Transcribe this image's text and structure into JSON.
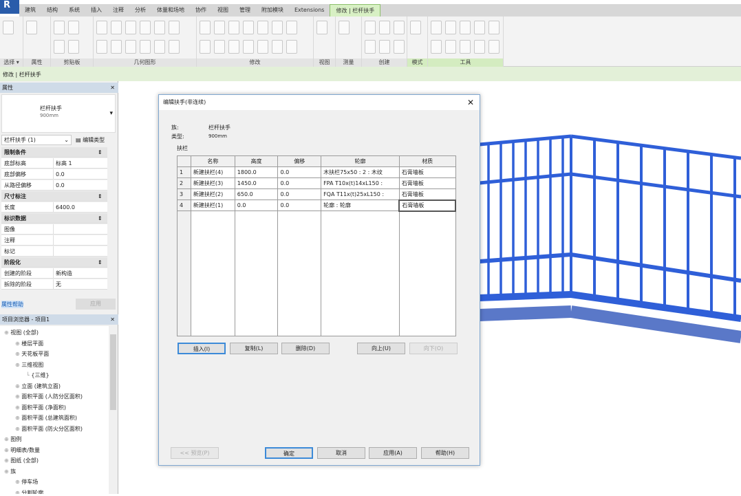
{
  "app": {
    "logo": "R"
  },
  "ribbon": {
    "tabs": [
      "建筑",
      "结构",
      "系统",
      "插入",
      "注释",
      "分析",
      "体量和场地",
      "协作",
      "视图",
      "管理",
      "附加模块",
      "Extensions",
      "修改 | 栏杆扶手"
    ],
    "active_tab": "修改 | 栏杆扶手",
    "panels": [
      "选择 ▾",
      "属性",
      "剪贴板",
      "几何图形",
      "修改",
      "视图",
      "测量",
      "创建",
      "模式",
      "工具"
    ],
    "accent": "#8cc06a"
  },
  "optbar": {
    "context": "修改 | 栏杆扶手"
  },
  "properties": {
    "title": "属性",
    "type_name": "栏杆扶手",
    "type_sub": "900mm",
    "selector": "栏杆扶手 (1)",
    "edit_type": "编辑类型",
    "groups": [
      {
        "name": "限制条件",
        "rows": [
          [
            "底部标高",
            "标高 1"
          ],
          [
            "底部偏移",
            "0.0"
          ],
          [
            "从路径偏移",
            "0.0"
          ]
        ]
      },
      {
        "name": "尺寸标注",
        "rows": [
          [
            "长度",
            "6400.0"
          ]
        ]
      },
      {
        "name": "标识数据",
        "rows": [
          [
            "图像",
            ""
          ],
          [
            "注释",
            ""
          ],
          [
            "标记",
            ""
          ]
        ]
      },
      {
        "name": "阶段化",
        "rows": [
          [
            "创建的阶段",
            "新构造"
          ],
          [
            "拆除的阶段",
            "无"
          ]
        ]
      }
    ],
    "help": "属性帮助",
    "apply": "应用"
  },
  "browser": {
    "title": "项目浏览器 - 项目1",
    "items": [
      {
        "label": "视图 (全部)",
        "level": 0
      },
      {
        "label": "楼层平面",
        "level": 1
      },
      {
        "label": "天花板平面",
        "level": 1
      },
      {
        "label": "三维视图",
        "level": 1
      },
      {
        "label": "{三维}",
        "level": 2
      },
      {
        "label": "立面 (建筑立面)",
        "level": 1
      },
      {
        "label": "面积平面 (人防分区面积)",
        "level": 1
      },
      {
        "label": "面积平面 (净面积)",
        "level": 1
      },
      {
        "label": "面积平面 (总建筑面积)",
        "level": 1
      },
      {
        "label": "面积平面 (防火分区面积)",
        "level": 1
      },
      {
        "label": "图例",
        "level": 0
      },
      {
        "label": "明细表/数量",
        "level": 0
      },
      {
        "label": "图纸 (全部)",
        "level": 0
      },
      {
        "label": "族",
        "level": 0
      },
      {
        "label": "停车场",
        "level": 1
      },
      {
        "label": "分割轮廓",
        "level": 1
      }
    ]
  },
  "dialog": {
    "title": "编辑扶手(非连续)",
    "family_label": "族:",
    "family": "栏杆扶手",
    "type_label": "类型:",
    "type": "900mm",
    "section": "扶栏",
    "columns": [
      "名称",
      "高度",
      "偏移",
      "轮廓",
      "材质"
    ],
    "rows": [
      [
        "1",
        "新建扶栏(4)",
        "1800.0",
        "0.0",
        "木扶栏75x50 : 2 : 木纹",
        "石膏墙板"
      ],
      [
        "2",
        "新建扶栏(3)",
        "1450.0",
        "0.0",
        "FPA T10x(t)14xL150 :",
        "石膏墙板"
      ],
      [
        "3",
        "新建扶栏(2)",
        "650.0",
        "0.0",
        "FQA T11x(t)25xL150 :",
        "石膏墙板"
      ],
      [
        "4",
        "新建扶栏(1)",
        "0.0",
        "0.0",
        "轮廓 : 轮廓",
        "石膏墙板"
      ]
    ],
    "buttons": {
      "insert": "插入(I)",
      "copy": "复制(L)",
      "delete": "删除(D)",
      "up": "向上(U)",
      "down": "向下(O)",
      "preview": "<< 预览(P)",
      "ok": "确定",
      "cancel": "取消",
      "apply": "应用(A)",
      "help": "帮助(H)"
    }
  },
  "viewport": {
    "railing_color": "#2f5fd8"
  }
}
